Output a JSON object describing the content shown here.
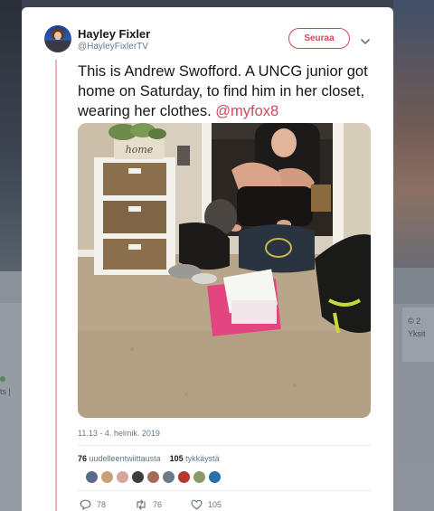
{
  "tweet": {
    "display_name": "Hayley Fixler",
    "handle": "@HayleyFixlerTV",
    "follow_label": "Seuraa",
    "text": "This is Andrew Swofford. A UNCG junior got home on Saturday, to find him in her closet, wearing her clothes.",
    "mention": "@myfox8",
    "timestamp": "11.13 - 4. helmik. 2019",
    "retweets_count": "76",
    "retweets_label": "uudelleentwiittausta",
    "likes_count": "105",
    "likes_label": "tykkäystä",
    "reply_count": "78",
    "retweet_action_count": "76",
    "like_action_count": "105"
  },
  "photo": {
    "basket_label": "home"
  },
  "background": {
    "right_card_line1": "© 2",
    "right_card_line2": "Yksit",
    "left_text": "ts |"
  },
  "icons": {
    "more": "chevron-down-icon",
    "reply": "reply-icon",
    "retweet": "retweet-icon",
    "like": "heart-icon"
  },
  "colors": {
    "accent": "#d6455a",
    "thread_line": "#e6b5b8",
    "secondary_text": "#657786"
  },
  "liker_avatar_colors": [
    "#5b6b8c",
    "#c8a07a",
    "#d9a3a0",
    "#3d3d3d",
    "#a46b5a",
    "#6d7a8a",
    "#b8352e",
    "#8a9a6a",
    "#2d6fa8"
  ]
}
